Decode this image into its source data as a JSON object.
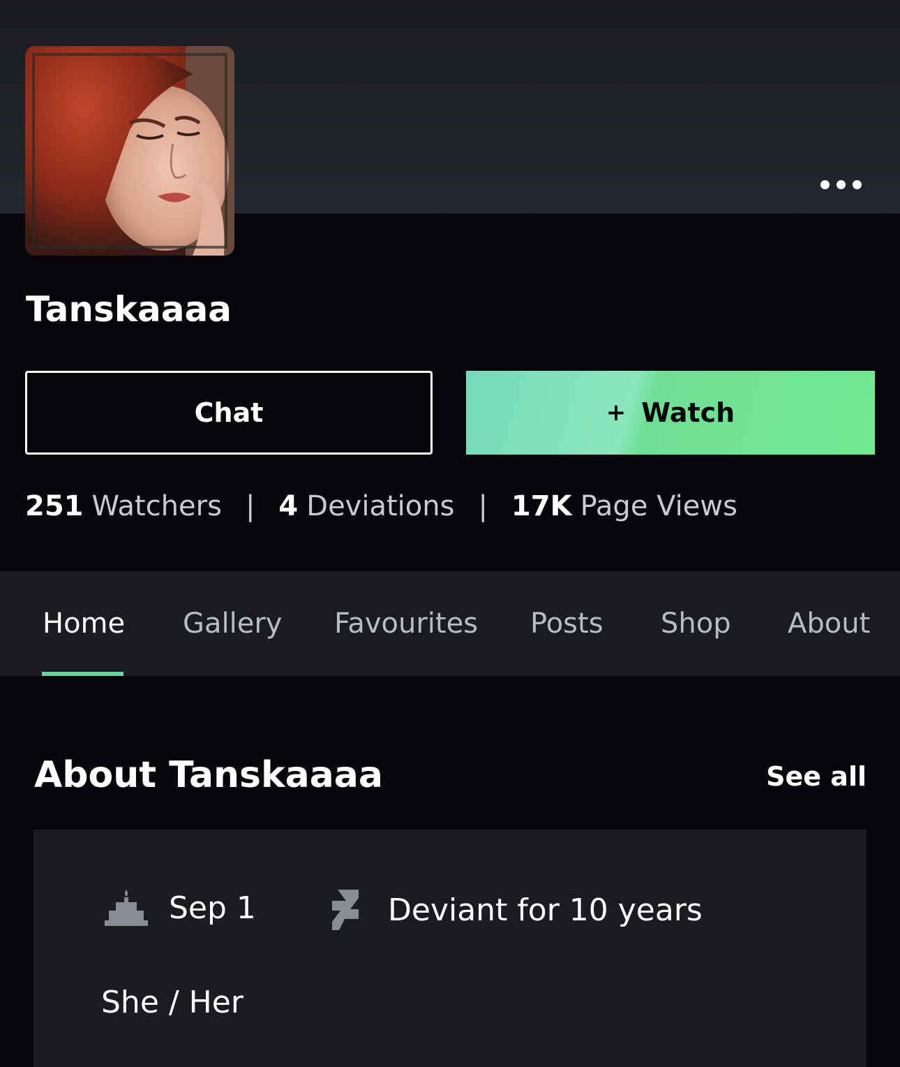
{
  "profile": {
    "username": "Tanskaaaa"
  },
  "actions": {
    "chat_label": "Chat",
    "watch_plus": "+",
    "watch_label": "Watch"
  },
  "stats": {
    "watchers_count": "251",
    "watchers_label": "Watchers",
    "deviations_count": "4",
    "deviations_label": "Deviations",
    "views_count": "17K",
    "views_label": "Page Views",
    "separator": "|"
  },
  "tabs": [
    {
      "label": "Home",
      "active": true
    },
    {
      "label": "Gallery",
      "active": false
    },
    {
      "label": "Favourites",
      "active": false
    },
    {
      "label": "Posts",
      "active": false
    },
    {
      "label": "Shop",
      "active": false
    },
    {
      "label": "About",
      "active": false
    }
  ],
  "about": {
    "title": "About Tanskaaaa",
    "see_all": "See all",
    "birthday": "Sep 1",
    "deviant_since": "Deviant for 10 years",
    "pronouns": "She / Her"
  },
  "icons": {
    "more": "more-horizontal-icon",
    "birthday": "birthday-cake-icon",
    "deviant": "deviantart-logo-icon"
  },
  "colors": {
    "accent": "#5fd6a0",
    "background": "#06070b",
    "panel": "#1a1c21"
  }
}
